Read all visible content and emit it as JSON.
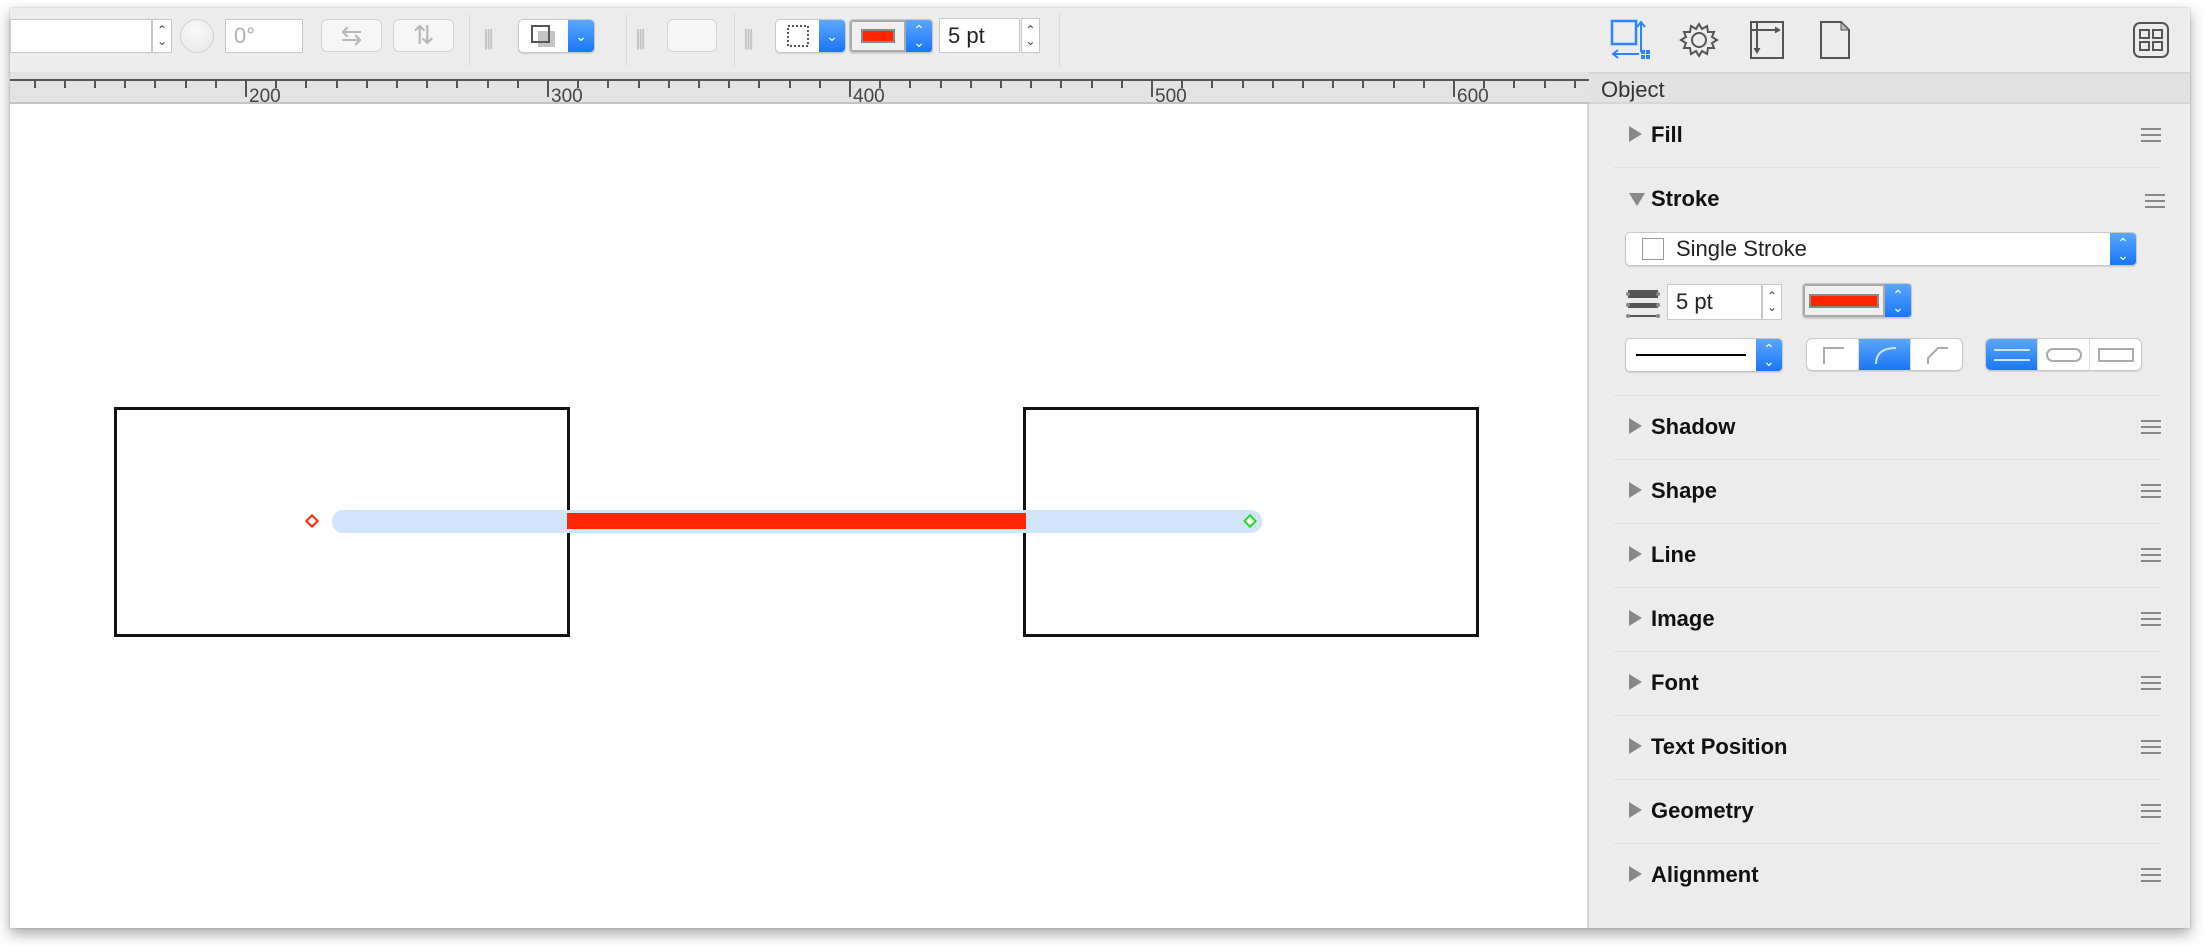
{
  "toolbar": {
    "position_field_value": "",
    "rotation_value": "0°",
    "flip_horizontal_icon": "arrows-left-right-icon",
    "flip_vertical_icon": "arrows-up-down-icon",
    "shadow_style_icon": "shadow-square-icon",
    "stroke_style_icon": "dotted-square-icon",
    "stroke_color": "#ff2600",
    "stroke_width_value": "5 pt"
  },
  "ruler": {
    "unit_step_minor": 10,
    "labels": [
      "200",
      "300",
      "400",
      "500",
      "600"
    ]
  },
  "canvas": {
    "shapes": [
      {
        "type": "rectangle",
        "name": "left-box"
      },
      {
        "type": "rectangle",
        "name": "right-box"
      }
    ],
    "line": {
      "stroke_color": "#ff2600",
      "selection_color": "#d0e5fb",
      "start_handle_color": "#ff2600",
      "end_handle_color": "#22dd22",
      "selected": true
    }
  },
  "inspector": {
    "tabs": [
      {
        "name": "object-tab",
        "icon": "object-geometry-icon",
        "active": true
      },
      {
        "name": "properties-tab",
        "icon": "gear-icon",
        "active": false
      },
      {
        "name": "canvas-tab",
        "icon": "canvas-size-icon",
        "active": false
      },
      {
        "name": "document-tab",
        "icon": "document-icon",
        "active": false
      }
    ],
    "layout_button_icon": "grid-icon",
    "header": "Object",
    "sections": [
      {
        "title": "Fill",
        "expanded": false
      },
      {
        "title": "Stroke",
        "expanded": true
      },
      {
        "title": "Shadow",
        "expanded": false
      },
      {
        "title": "Shape",
        "expanded": false
      },
      {
        "title": "Line",
        "expanded": false
      },
      {
        "title": "Image",
        "expanded": false
      },
      {
        "title": "Font",
        "expanded": false
      },
      {
        "title": "Text Position",
        "expanded": false
      },
      {
        "title": "Geometry",
        "expanded": false
      },
      {
        "title": "Alignment",
        "expanded": false
      }
    ],
    "stroke": {
      "type_value": "Single Stroke",
      "width_value": "5 pt",
      "color": "#ff2600",
      "pattern_value": "solid",
      "corner_options": [
        "square-corner",
        "round-corner",
        "bevel-corner"
      ],
      "corner_selected": 1,
      "cap_options": [
        "butt-cap",
        "round-cap",
        "square-cap"
      ],
      "cap_selected": 0
    }
  }
}
